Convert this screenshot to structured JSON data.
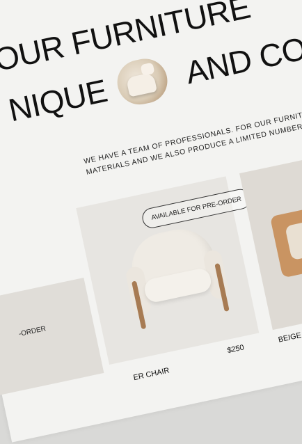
{
  "hero": {
    "line1": "OUR FURNITURE",
    "line2_left": "NIQUE",
    "line2_right": "AND COZY"
  },
  "intro": {
    "text": "WE HAVE A TEAM OF PROFESSIONALS. FOR OUR FURNITURE, WE USE HIGH QUALITY MATERIALS AND WE ALSO PRODUCE A LIMITED NUMBER OF ITEMS"
  },
  "products": {
    "left_badge": "-ORDER",
    "main": {
      "badge": "AVAILABLE FOR PRE-ORDER",
      "name": "ER CHAIR",
      "price": "$250"
    },
    "side": {
      "name": "BEIGE SHE"
    }
  },
  "colors": {
    "background": "#f3f3f1",
    "text": "#111111",
    "wood": "#a77b53"
  }
}
